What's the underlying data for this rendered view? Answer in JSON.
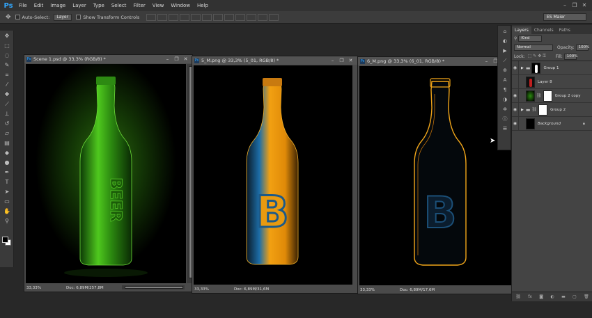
{
  "app": {
    "logo": "Ps"
  },
  "menu": [
    "File",
    "Edit",
    "Image",
    "Layer",
    "Type",
    "Select",
    "Filter",
    "View",
    "Window",
    "Help"
  ],
  "window_controls": [
    "–",
    "❐",
    "✕"
  ],
  "options": {
    "auto_select_label": "Auto-Select:",
    "auto_select_value": "Layer",
    "show_transform_label": "Show Transform Controls",
    "workspace": "ES Maier"
  },
  "documents": [
    {
      "title": "Scene 1.psd @ 33,3% (RGB/8) *",
      "zoom": "33,33%",
      "doc_info": "Doc: 6,89M/257,8M",
      "bottle_color": "green"
    },
    {
      "title": "5_M.png @ 33,3% (5_01, RGB/8) *",
      "zoom": "33,33%",
      "doc_info": "Doc: 6,89M/31,6M",
      "bottle_color": "amber"
    },
    {
      "title": "6_M.png @ 33,3% (6_01, RGB/8) *",
      "zoom": "33,33%",
      "doc_info": "Doc: 6,89M/17,6M",
      "bottle_color": "outline"
    }
  ],
  "bottle_text": "BEER",
  "bottle_letter": "B",
  "layers_panel": {
    "tabs": [
      "Layers",
      "Channels",
      "Paths"
    ],
    "kind": "Kind",
    "blend": "Normal",
    "opacity_label": "Opacity:",
    "opacity_value": "100%",
    "lock_label": "Lock:",
    "fill_label": "Fill:",
    "fill_value": "100%",
    "layers": [
      {
        "name": "Group 1",
        "visible": true
      },
      {
        "name": "Layer 8",
        "visible": false
      },
      {
        "name": "Group 2 copy",
        "visible": true
      },
      {
        "name": "Group 2",
        "visible": true
      },
      {
        "name": "Background",
        "visible": true
      }
    ],
    "footer_icons": [
      "link-icon",
      "fx-icon",
      "mask-icon",
      "adjustment-icon",
      "folder-icon",
      "new-layer-icon",
      "trash-icon"
    ]
  },
  "colors": {
    "accent": "#31a8ff",
    "panel": "#444444",
    "workspace": "#282828"
  }
}
